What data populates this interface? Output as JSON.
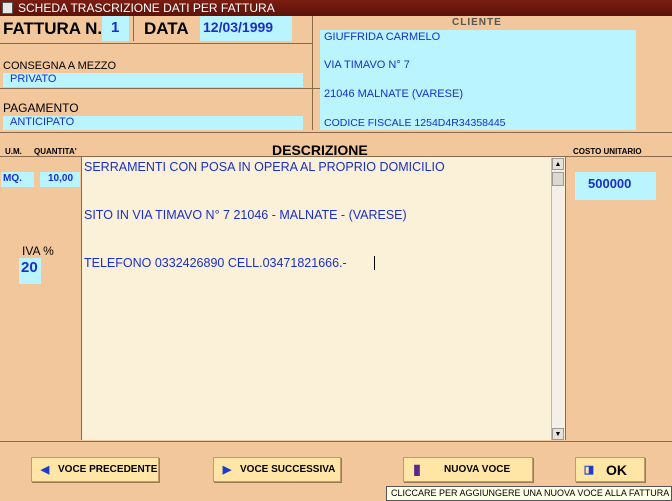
{
  "window": {
    "title": "SCHEDA TRASCRIZIONE DATI PER FATTURA"
  },
  "header": {
    "invoice_label": "FATTURA N.",
    "invoice_number": "1",
    "date_label": "DATA",
    "date_value": "12/03/1999",
    "delivery_label": "CONSEGNA A MEZZO",
    "delivery_value": "PRIVATO",
    "payment_label": "PAGAMENTO",
    "payment_value": "ANTICIPATO"
  },
  "client": {
    "title": "CLIENTE",
    "name": "GIUFFRIDA CARMELO",
    "street": "VIA TIMAVO N° 7",
    "city": "21046 MALNATE (VARESE)",
    "tax_code": "CODICE FISCALE 1254D4R34358445"
  },
  "columns": {
    "unit": "U.M.",
    "quantity": "QUANTITA'",
    "description": "DESCRIZIONE",
    "unit_cost": "COSTO UNITARIO"
  },
  "item": {
    "unit": "MQ.",
    "quantity": "10,00",
    "vat_label": "IVA %",
    "vat_value": "20",
    "unit_cost": "500000",
    "description_lines": [
      "SERRAMENTI CON POSA IN OPERA AL PROPRIO DOMICILIO",
      "SITO IN VIA TIMAVO N° 7 21046 - MALNATE - (VARESE)",
      "TELEFONO 0332426890 CELL.03471821666.-"
    ]
  },
  "buttons": {
    "previous": "VOCE PRECEDENTE",
    "next": "VOCE SUCCESSIVA",
    "new_item": "NUOVA VOCE",
    "ok": "OK"
  },
  "status": {
    "tooltip": "CLICCARE PER AGGIUNGERE UNA NUOVA VOCE ALLA FATTURA"
  },
  "colors": {
    "background": "#f2c79c",
    "field": "#b9f4ff",
    "field_text": "#1a2fc8",
    "titlebar": "#6b1a0e",
    "button": "#ffe6a6"
  }
}
